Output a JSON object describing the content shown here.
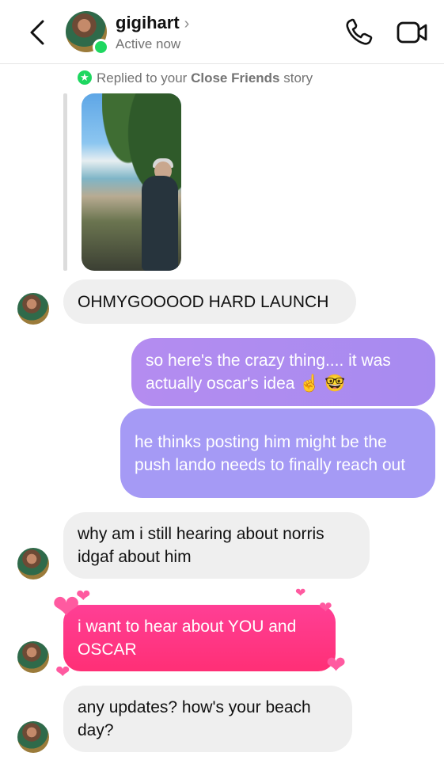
{
  "header": {
    "username": "gigihart",
    "status": "Active now"
  },
  "story_reply": {
    "prefix": "Replied to your",
    "highlight": "Close Friends",
    "suffix": "story"
  },
  "messages": [
    {
      "from": "them",
      "text": "OHMYGOOOOD HARD LAUNCH"
    },
    {
      "from": "me",
      "text": "so here's the crazy thing.... it was actually oscar's idea ☝️ 🤓"
    },
    {
      "from": "me",
      "text": "he thinks posting him might be the push lando needs to finally reach out"
    },
    {
      "from": "them",
      "text": "why am i still hearing about norris idgaf about him"
    },
    {
      "from": "them",
      "text": "i want to hear about YOU and OSCAR",
      "effect": "hearts"
    },
    {
      "from": "them",
      "text": "any updates? how's your beach day?"
    }
  ],
  "colors": {
    "online": "#1ed760",
    "incoming_bubble": "#efefef",
    "outgoing_bubble": "#a59af5",
    "heart_bubble": "#ff3f95"
  },
  "icons": [
    "back-icon",
    "phone-icon",
    "video-camera-icon",
    "star-icon",
    "heart-icon"
  ]
}
